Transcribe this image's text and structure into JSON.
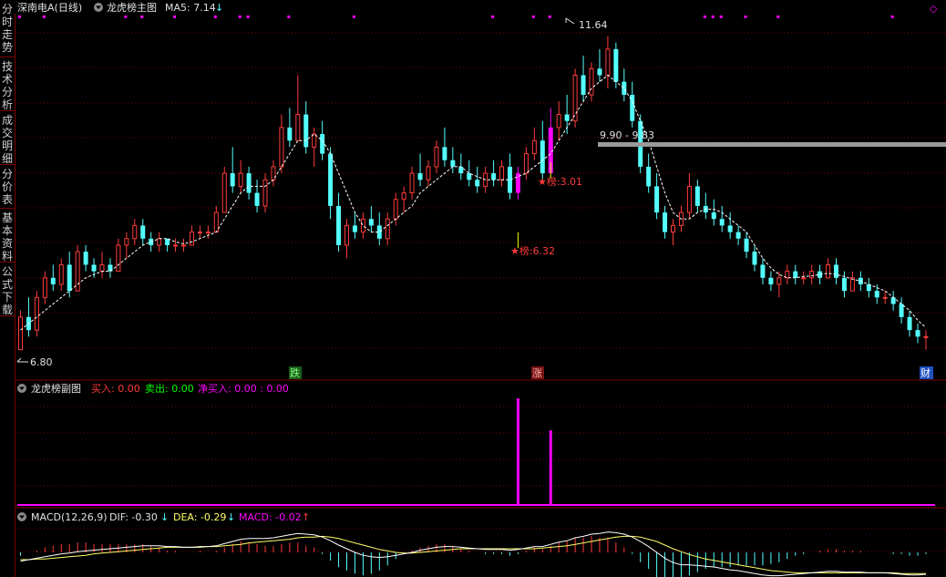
{
  "side_tabs": [
    {
      "label": "分时走势",
      "active": false
    },
    {
      "label": "技术分析",
      "active": true
    },
    {
      "label": "成交明细",
      "active": false
    },
    {
      "label": "分价表",
      "active": false
    },
    {
      "label": "基本资料",
      "active": false
    },
    {
      "label": "公式下载",
      "active": false
    }
  ],
  "main_panel": {
    "stock": "深南电A(日线)",
    "indicator": "龙虎榜主图",
    "ma_label": "MA5: 7.14",
    "ma_arrow": "↓",
    "high_label": "11.64",
    "low_label": "6.80",
    "range_label": "9.90 - 9.83",
    "bang_labels": [
      "★榜:3.01",
      "★榜:6.32"
    ],
    "badges": [
      "跌",
      "涨",
      "财"
    ],
    "top_right": "◇"
  },
  "sub_panel": {
    "title": "龙虎榜副图",
    "buy": "买入: 0.00",
    "sell": "卖出: 0.00",
    "net": "净买入: 0.00 : 0.00"
  },
  "macd_panel": {
    "title": "MACD(12,26,9)",
    "dif": "DIF: -0.30",
    "dif_arrow": "↓",
    "dea": "DEA: -0.29",
    "dea_arrow": "↓",
    "macd": "MACD: -0.02",
    "macd_arrow": "↑"
  },
  "colors": {
    "up": "#ff3b3b",
    "down": "#54ffff",
    "accent": "#ff00ff",
    "grid": "#7a0000",
    "ma": "#ffffff",
    "dea": "#ffff66",
    "range": "#9a9a9a"
  },
  "chart_data": {
    "type": "candlestick",
    "y_range": [
      6.6,
      11.9
    ],
    "ohlc": [
      [
        6.8,
        7.4,
        6.8,
        7.3
      ],
      [
        7.3,
        7.6,
        7.0,
        7.1
      ],
      [
        7.1,
        7.7,
        7.0,
        7.6
      ],
      [
        7.6,
        8.0,
        7.5,
        7.9
      ],
      [
        7.9,
        8.1,
        7.7,
        7.8
      ],
      [
        7.8,
        8.2,
        7.7,
        8.1
      ],
      [
        8.1,
        8.3,
        7.6,
        7.7
      ],
      [
        7.7,
        8.4,
        7.7,
        8.3
      ],
      [
        8.3,
        8.4,
        8.0,
        8.1
      ],
      [
        8.1,
        8.2,
        7.9,
        8.0
      ],
      [
        8.0,
        8.3,
        7.9,
        8.1
      ],
      [
        8.1,
        8.2,
        7.9,
        8.0
      ],
      [
        8.0,
        8.5,
        8.0,
        8.4
      ],
      [
        8.4,
        8.6,
        8.2,
        8.5
      ],
      [
        8.5,
        8.8,
        8.4,
        8.7
      ],
      [
        8.7,
        8.8,
        8.4,
        8.5
      ],
      [
        8.5,
        8.6,
        8.3,
        8.4
      ],
      [
        8.4,
        8.6,
        8.3,
        8.5
      ],
      [
        8.5,
        8.5,
        8.3,
        8.4
      ],
      [
        8.4,
        8.5,
        8.3,
        8.4
      ],
      [
        8.4,
        8.5,
        8.3,
        8.4
      ],
      [
        8.4,
        8.7,
        8.4,
        8.6
      ],
      [
        8.6,
        8.7,
        8.5,
        8.6
      ],
      [
        8.6,
        8.7,
        8.5,
        8.6
      ],
      [
        8.6,
        9.0,
        8.6,
        8.9
      ],
      [
        8.9,
        9.6,
        8.9,
        9.5
      ],
      [
        9.5,
        9.9,
        9.2,
        9.3
      ],
      [
        9.3,
        9.7,
        9.2,
        9.5
      ],
      [
        9.5,
        9.6,
        9.1,
        9.2
      ],
      [
        9.2,
        9.4,
        8.9,
        9.0
      ],
      [
        9.0,
        9.5,
        8.9,
        9.4
      ],
      [
        9.4,
        9.7,
        9.3,
        9.6
      ],
      [
        9.6,
        10.4,
        9.5,
        10.2
      ],
      [
        10.2,
        10.5,
        9.9,
        10.0
      ],
      [
        10.0,
        11.0,
        10.0,
        10.4
      ],
      [
        10.4,
        10.6,
        9.8,
        9.9
      ],
      [
        9.9,
        10.2,
        9.6,
        10.1
      ],
      [
        10.1,
        10.3,
        9.7,
        9.8
      ],
      [
        9.8,
        9.9,
        8.8,
        9.0
      ],
      [
        9.0,
        9.2,
        8.3,
        8.4
      ],
      [
        8.4,
        8.8,
        8.2,
        8.7
      ],
      [
        8.7,
        8.9,
        8.5,
        8.6
      ],
      [
        8.6,
        8.9,
        8.5,
        8.8
      ],
      [
        8.8,
        9.0,
        8.6,
        8.7
      ],
      [
        8.7,
        8.9,
        8.4,
        8.5
      ],
      [
        8.5,
        8.9,
        8.4,
        8.8
      ],
      [
        8.8,
        9.2,
        8.7,
        9.1
      ],
      [
        9.1,
        9.3,
        8.9,
        9.2
      ],
      [
        9.2,
        9.6,
        9.1,
        9.5
      ],
      [
        9.5,
        9.8,
        9.3,
        9.4
      ],
      [
        9.4,
        9.7,
        9.3,
        9.6
      ],
      [
        9.6,
        10.0,
        9.5,
        9.9
      ],
      [
        9.9,
        10.2,
        9.6,
        9.7
      ],
      [
        9.7,
        9.9,
        9.5,
        9.6
      ],
      [
        9.6,
        9.8,
        9.4,
        9.5
      ],
      [
        9.5,
        9.7,
        9.3,
        9.4
      ],
      [
        9.4,
        9.6,
        9.2,
        9.3
      ],
      [
        9.3,
        9.6,
        9.2,
        9.5
      ],
      [
        9.5,
        9.7,
        9.3,
        9.4
      ],
      [
        9.4,
        9.7,
        9.3,
        9.6
      ],
      [
        9.6,
        9.8,
        9.1,
        9.2
      ],
      [
        9.2,
        9.6,
        9.1,
        9.5
      ],
      [
        9.5,
        9.9,
        9.4,
        9.8
      ],
      [
        9.8,
        10.2,
        9.7,
        10.0
      ],
      [
        10.0,
        10.3,
        9.4,
        9.5
      ],
      [
        9.5,
        10.5,
        9.5,
        10.2
      ],
      [
        10.2,
        10.6,
        10.0,
        10.4
      ],
      [
        10.4,
        10.7,
        10.1,
        10.3
      ],
      [
        10.3,
        11.1,
        10.2,
        11.0
      ],
      [
        11.0,
        11.3,
        10.6,
        10.7
      ],
      [
        10.7,
        11.2,
        10.6,
        11.1
      ],
      [
        11.1,
        11.4,
        10.9,
        11.0
      ],
      [
        11.0,
        11.6,
        10.8,
        11.4
      ],
      [
        11.4,
        11.5,
        10.8,
        10.9
      ],
      [
        10.9,
        11.1,
        10.6,
        10.7
      ],
      [
        10.7,
        10.9,
        10.2,
        10.3
      ],
      [
        10.3,
        10.4,
        9.5,
        9.6
      ],
      [
        9.6,
        9.8,
        9.2,
        9.3
      ],
      [
        9.3,
        9.5,
        8.8,
        8.9
      ],
      [
        8.9,
        9.0,
        8.5,
        8.6
      ],
      [
        8.6,
        8.8,
        8.4,
        8.7
      ],
      [
        8.7,
        9.0,
        8.6,
        8.9
      ],
      [
        8.9,
        9.5,
        8.8,
        9.3
      ],
      [
        9.3,
        9.4,
        8.9,
        9.0
      ],
      [
        9.0,
        9.2,
        8.8,
        8.9
      ],
      [
        8.9,
        9.1,
        8.7,
        8.8
      ],
      [
        8.8,
        9.0,
        8.6,
        8.7
      ],
      [
        8.7,
        8.9,
        8.5,
        8.6
      ],
      [
        8.6,
        8.7,
        8.4,
        8.5
      ],
      [
        8.5,
        8.6,
        8.2,
        8.3
      ],
      [
        8.3,
        8.4,
        8.0,
        8.1
      ],
      [
        8.1,
        8.2,
        7.8,
        7.9
      ],
      [
        7.9,
        8.0,
        7.7,
        7.8
      ],
      [
        7.8,
        8.0,
        7.6,
        7.9
      ],
      [
        7.9,
        8.1,
        7.8,
        8.0
      ],
      [
        8.0,
        8.1,
        7.8,
        7.9
      ],
      [
        7.9,
        8.0,
        7.8,
        7.9
      ],
      [
        7.9,
        8.1,
        7.8,
        8.0
      ],
      [
        8.0,
        8.1,
        7.8,
        7.9
      ],
      [
        7.9,
        8.2,
        7.9,
        8.1
      ],
      [
        8.1,
        8.2,
        7.8,
        7.9
      ],
      [
        7.9,
        8.0,
        7.6,
        7.7
      ],
      [
        7.7,
        8.0,
        7.7,
        7.9
      ],
      [
        7.9,
        8.0,
        7.7,
        7.8
      ],
      [
        7.8,
        7.9,
        7.6,
        7.7
      ],
      [
        7.7,
        7.8,
        7.5,
        7.6
      ],
      [
        7.6,
        7.7,
        7.5,
        7.6
      ],
      [
        7.6,
        7.7,
        7.4,
        7.5
      ],
      [
        7.5,
        7.6,
        7.2,
        7.3
      ],
      [
        7.3,
        7.4,
        7.0,
        7.1
      ],
      [
        7.1,
        7.2,
        6.9,
        7.0
      ],
      [
        7.0,
        7.1,
        6.8,
        7.0
      ]
    ],
    "ma5": [
      7.1,
      7.2,
      7.3,
      7.4,
      7.5,
      7.6,
      7.7,
      7.8,
      7.9,
      7.95,
      8.0,
      8.0,
      8.1,
      8.2,
      8.3,
      8.4,
      8.45,
      8.5,
      8.5,
      8.45,
      8.42,
      8.45,
      8.5,
      8.55,
      8.6,
      8.8,
      9.0,
      9.2,
      9.3,
      9.3,
      9.3,
      9.4,
      9.6,
      9.8,
      10.0,
      10.0,
      10.1,
      10.0,
      9.8,
      9.5,
      9.2,
      8.9,
      8.7,
      8.6,
      8.6,
      8.7,
      8.8,
      8.9,
      9.0,
      9.2,
      9.3,
      9.4,
      9.5,
      9.6,
      9.6,
      9.5,
      9.45,
      9.4,
      9.4,
      9.4,
      9.4,
      9.45,
      9.5,
      9.6,
      9.7,
      9.8,
      10.0,
      10.2,
      10.4,
      10.6,
      10.8,
      10.9,
      11.0,
      10.9,
      10.8,
      10.6,
      10.3,
      10.0,
      9.6,
      9.2,
      8.9,
      8.8,
      8.8,
      8.9,
      8.95,
      8.95,
      8.9,
      8.8,
      8.7,
      8.6,
      8.4,
      8.2,
      8.05,
      7.95,
      7.9,
      7.9,
      7.92,
      7.93,
      7.95,
      7.97,
      7.95,
      7.92,
      7.88,
      7.85,
      7.8,
      7.75,
      7.7,
      7.6,
      7.5,
      7.4,
      7.25,
      7.14
    ],
    "bang_days": [
      [
        61,
        6.32
      ],
      [
        65,
        3.01
      ]
    ],
    "sub_bars": [
      [
        61,
        1.0
      ],
      [
        65,
        0.7
      ]
    ],
    "macd_dif": [
      -0.12,
      -0.1,
      -0.08,
      -0.06,
      -0.04,
      -0.02,
      -0.01,
      0.01,
      0.02,
      0.03,
      0.04,
      0.05,
      0.06,
      0.07,
      0.08,
      0.09,
      0.09,
      0.09,
      0.08,
      0.08,
      0.07,
      0.07,
      0.08,
      0.08,
      0.09,
      0.12,
      0.15,
      0.18,
      0.19,
      0.19,
      0.19,
      0.2,
      0.22,
      0.24,
      0.26,
      0.25,
      0.24,
      0.21,
      0.16,
      0.1,
      0.05,
      0.0,
      -0.04,
      -0.06,
      -0.07,
      -0.06,
      -0.04,
      -0.02,
      0.0,
      0.03,
      0.05,
      0.07,
      0.08,
      0.08,
      0.07,
      0.06,
      0.05,
      0.04,
      0.04,
      0.04,
      0.03,
      0.04,
      0.06,
      0.08,
      0.08,
      0.11,
      0.14,
      0.16,
      0.2,
      0.22,
      0.25,
      0.26,
      0.28,
      0.27,
      0.25,
      0.21,
      0.15,
      0.08,
      0.0,
      -0.08,
      -0.14,
      -0.17,
      -0.17,
      -0.18,
      -0.19,
      -0.2,
      -0.22,
      -0.24,
      -0.25,
      -0.27,
      -0.29,
      -0.31,
      -0.32,
      -0.32,
      -0.31,
      -0.3,
      -0.29,
      -0.28,
      -0.27,
      -0.26,
      -0.26,
      -0.27,
      -0.27,
      -0.27,
      -0.28,
      -0.28,
      -0.28,
      -0.29,
      -0.3,
      -0.31,
      -0.31,
      -0.3
    ],
    "macd_dea": [
      -0.1,
      -0.1,
      -0.09,
      -0.09,
      -0.08,
      -0.07,
      -0.06,
      -0.05,
      -0.04,
      -0.02,
      -0.01,
      0.0,
      0.01,
      0.02,
      0.03,
      0.04,
      0.05,
      0.06,
      0.07,
      0.07,
      0.07,
      0.07,
      0.07,
      0.08,
      0.08,
      0.09,
      0.1,
      0.11,
      0.13,
      0.14,
      0.15,
      0.16,
      0.17,
      0.18,
      0.2,
      0.21,
      0.21,
      0.22,
      0.21,
      0.19,
      0.16,
      0.13,
      0.1,
      0.07,
      0.04,
      0.02,
      0.0,
      -0.01,
      -0.01,
      0.0,
      0.01,
      0.02,
      0.03,
      0.04,
      0.05,
      0.05,
      0.05,
      0.05,
      0.05,
      0.05,
      0.05,
      0.05,
      0.05,
      0.05,
      0.06,
      0.07,
      0.08,
      0.09,
      0.11,
      0.13,
      0.15,
      0.17,
      0.19,
      0.21,
      0.22,
      0.22,
      0.21,
      0.18,
      0.15,
      0.1,
      0.05,
      0.01,
      -0.03,
      -0.06,
      -0.09,
      -0.11,
      -0.13,
      -0.15,
      -0.17,
      -0.19,
      -0.21,
      -0.23,
      -0.25,
      -0.26,
      -0.27,
      -0.28,
      -0.28,
      -0.28,
      -0.28,
      -0.28,
      -0.28,
      -0.28,
      -0.28,
      -0.28,
      -0.28,
      -0.28,
      -0.28,
      -0.28,
      -0.29,
      -0.29,
      -0.29,
      -0.29
    ]
  }
}
